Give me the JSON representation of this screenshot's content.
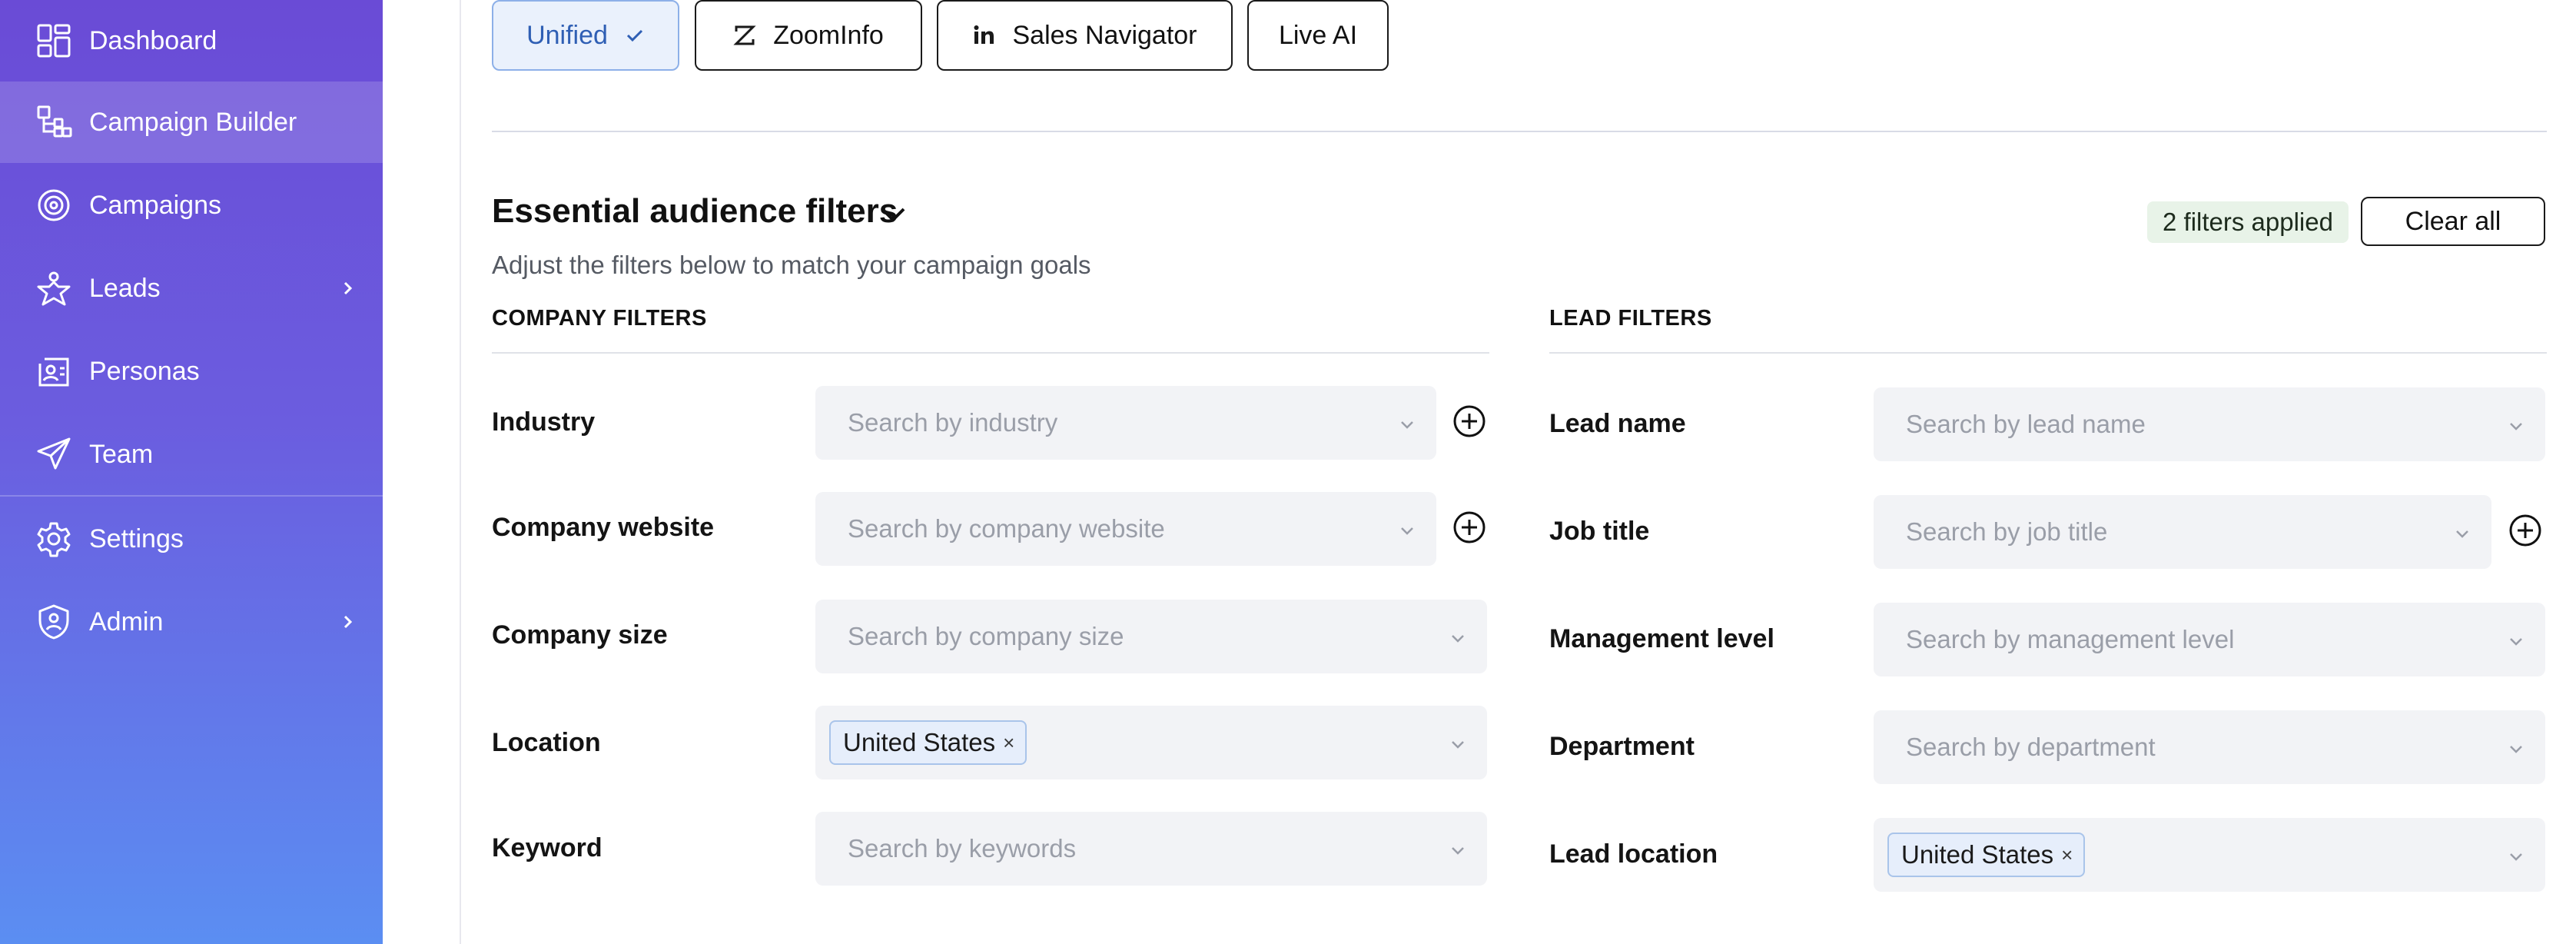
{
  "sidebar": {
    "items": [
      {
        "label": "Dashboard",
        "icon": "dashboard-icon"
      },
      {
        "label": "Campaign Builder",
        "icon": "campaign-builder-icon",
        "active": true
      },
      {
        "label": "Campaigns",
        "icon": "target-icon"
      },
      {
        "label": "Leads",
        "icon": "star-person-icon",
        "has_submenu": true
      },
      {
        "label": "Personas",
        "icon": "id-card-icon"
      },
      {
        "label": "Team",
        "icon": "send-icon"
      },
      {
        "label": "Settings",
        "icon": "gear-icon"
      },
      {
        "label": "Admin",
        "icon": "shield-user-icon",
        "has_submenu": true
      }
    ]
  },
  "sources": {
    "tabs": [
      {
        "label": "Unified",
        "selected": true,
        "icon": "check-icon"
      },
      {
        "label": "ZoomInfo",
        "icon": "zoominfo-icon"
      },
      {
        "label": "Sales Navigator",
        "icon": "linkedin-icon"
      },
      {
        "label": "Live AI"
      }
    ]
  },
  "section": {
    "title": "Essential audience filters",
    "subtitle": "Adjust the filters below to match your campaign goals",
    "filters_applied": "2 filters applied",
    "clear_all": "Clear all"
  },
  "company_filters": {
    "heading": "COMPANY FILTERS",
    "rows": [
      {
        "label": "Industry",
        "placeholder": "Search by industry"
      },
      {
        "label": "Company website",
        "placeholder": "Search by company website"
      },
      {
        "label": "Company size",
        "placeholder": "Search by company size"
      },
      {
        "label": "Location",
        "chip": "United States"
      },
      {
        "label": "Keyword",
        "placeholder": "Search by keywords"
      }
    ]
  },
  "lead_filters": {
    "heading": "LEAD FILTERS",
    "rows": [
      {
        "label": "Lead name",
        "placeholder": "Search by lead name"
      },
      {
        "label": "Job title",
        "placeholder": "Search by job title"
      },
      {
        "label": "Management level",
        "placeholder": "Search by management level"
      },
      {
        "label": "Department",
        "placeholder": "Search by department"
      },
      {
        "label": "Lead location",
        "chip": "United States"
      }
    ]
  },
  "colors": {
    "sidebar_top": "#6a4bd6",
    "sidebar_bottom": "#5b8ef2",
    "selected_tab_bg": "#eaf1fc",
    "field_bg": "#f2f3f6",
    "badge_bg": "#e8f3e8"
  }
}
